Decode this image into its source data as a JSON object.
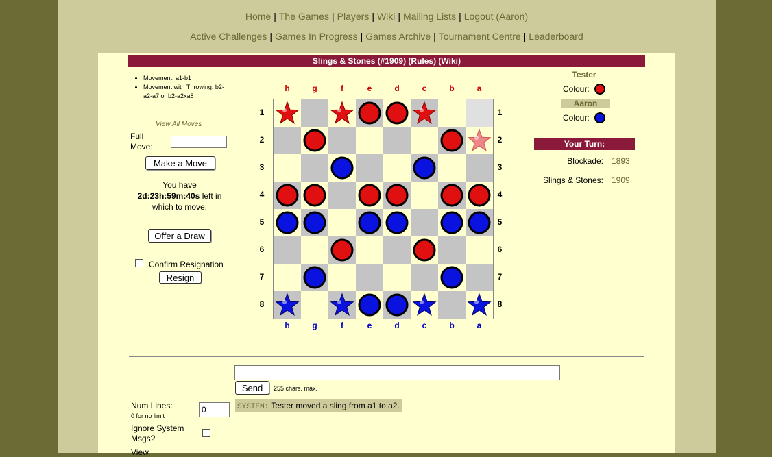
{
  "nav": {
    "primary": [
      "Home",
      "The Games",
      "Players",
      "Wiki",
      "Mailing Lists",
      "Logout (Aaron)"
    ],
    "secondary": [
      "Active Challenges",
      "Games In Progress",
      "Games Archive",
      "Tournament Centre",
      "Leaderboard"
    ]
  },
  "game": {
    "title": "Slings & Stones (#1909) (Rules) (Wiki)"
  },
  "moves": {
    "items": [
      "Movement: a1-b1",
      "Movement with Throwing: b2-a2-a7 or b2-a2xa8"
    ],
    "view_all": "View All Moves",
    "full_move_label": "Full Move:",
    "full_move_value": "",
    "make_move_label": "Make a Move",
    "time_prefix": "You have",
    "time_value": "2d:23h:59m:40s",
    "time_suffix": "left in which to move.",
    "offer_draw_label": "Offer a Draw",
    "confirm_resign_label": "Confirm Resignation",
    "resign_label": "Resign"
  },
  "board": {
    "columns": [
      "h",
      "g",
      "f",
      "e",
      "d",
      "c",
      "b",
      "a"
    ],
    "rows": [
      "1",
      "2",
      "3",
      "4",
      "5",
      "6",
      "7",
      "8"
    ],
    "highlight": "a1",
    "pieces": [
      {
        "sq": "h1",
        "color": "red",
        "kind": "star"
      },
      {
        "sq": "f1",
        "color": "red",
        "kind": "star"
      },
      {
        "sq": "e1",
        "color": "red",
        "kind": "stone"
      },
      {
        "sq": "d1",
        "color": "red",
        "kind": "stone"
      },
      {
        "sq": "c1",
        "color": "red",
        "kind": "star"
      },
      {
        "sq": "g2",
        "color": "red",
        "kind": "stone"
      },
      {
        "sq": "b2",
        "color": "red",
        "kind": "stone"
      },
      {
        "sq": "a2",
        "color": "red",
        "kind": "star",
        "faded": true
      },
      {
        "sq": "f3",
        "color": "blue",
        "kind": "stone"
      },
      {
        "sq": "c3",
        "color": "blue",
        "kind": "stone"
      },
      {
        "sq": "h4",
        "color": "red",
        "kind": "stone"
      },
      {
        "sq": "g4",
        "color": "red",
        "kind": "stone"
      },
      {
        "sq": "e4",
        "color": "red",
        "kind": "stone"
      },
      {
        "sq": "d4",
        "color": "red",
        "kind": "stone"
      },
      {
        "sq": "b4",
        "color": "red",
        "kind": "stone"
      },
      {
        "sq": "a4",
        "color": "red",
        "kind": "stone"
      },
      {
        "sq": "h5",
        "color": "blue",
        "kind": "stone"
      },
      {
        "sq": "g5",
        "color": "blue",
        "kind": "stone"
      },
      {
        "sq": "e5",
        "color": "blue",
        "kind": "stone"
      },
      {
        "sq": "d5",
        "color": "blue",
        "kind": "stone"
      },
      {
        "sq": "b5",
        "color": "blue",
        "kind": "stone"
      },
      {
        "sq": "a5",
        "color": "blue",
        "kind": "stone"
      },
      {
        "sq": "f6",
        "color": "red",
        "kind": "stone"
      },
      {
        "sq": "c6",
        "color": "red",
        "kind": "stone"
      },
      {
        "sq": "g7",
        "color": "blue",
        "kind": "stone"
      },
      {
        "sq": "b7",
        "color": "blue",
        "kind": "stone"
      },
      {
        "sq": "h8",
        "color": "blue",
        "kind": "star"
      },
      {
        "sq": "f8",
        "color": "blue",
        "kind": "star"
      },
      {
        "sq": "e8",
        "color": "blue",
        "kind": "stone"
      },
      {
        "sq": "d8",
        "color": "blue",
        "kind": "stone"
      },
      {
        "sq": "c8",
        "color": "blue",
        "kind": "star"
      },
      {
        "sq": "a8",
        "color": "blue",
        "kind": "star"
      }
    ],
    "colors": {
      "red": "#e01010",
      "blue": "#0a12e0",
      "light": "#ffffcf",
      "dark": "#c4c4c4"
    }
  },
  "players": {
    "p1_name": "Tester",
    "p2_name": "Aaron",
    "colour_label": "Colour:",
    "p1_colour": "#e01010",
    "p2_colour": "#0a12e0"
  },
  "turn": {
    "header": "Your Turn:",
    "games": [
      {
        "name": "Blockade:",
        "id": "1893"
      },
      {
        "name": "Slings & Stones:",
        "id": "1909"
      }
    ]
  },
  "chat": {
    "input_value": "",
    "send_label": "Send",
    "max_chars": "255 chars. max.",
    "num_lines_label": "Num Lines:",
    "num_lines_hint": "0 for no limit",
    "num_lines_value": "0",
    "ignore_label": "Ignore System Msgs?",
    "view_label": "View",
    "message_tag": "SYSTEM:",
    "message_text": "Tester moved a sling from a1 to a2."
  }
}
